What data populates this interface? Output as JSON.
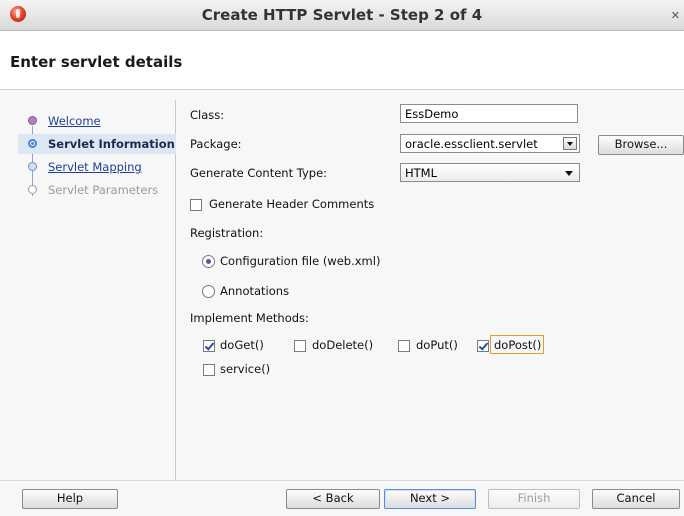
{
  "window": {
    "title": "Create HTTP Servlet - Step 2 of 4",
    "close_glyph": "✕",
    "app_icon": "oracle-jdeveloper-icon"
  },
  "header": {
    "title": "Enter servlet details"
  },
  "steps": [
    {
      "label": "Welcome",
      "state": "done"
    },
    {
      "label": "Servlet Information",
      "state": "active"
    },
    {
      "label": "Servlet Mapping",
      "state": "next"
    },
    {
      "label": "Servlet Parameters",
      "state": "disabled"
    }
  ],
  "form": {
    "class_label": "Class:",
    "class_value": "EssDemo",
    "package_label": "Package:",
    "package_value": "oracle.essclient.servlet",
    "browse_label": "Browse...",
    "content_type_label": "Generate Content Type:",
    "content_type_value": "HTML",
    "header_comments_label": "Generate Header Comments",
    "header_comments_checked": false,
    "registration_label": "Registration:",
    "registration_options": [
      {
        "label": "Configuration file (web.xml)",
        "selected": true
      },
      {
        "label": "Annotations",
        "selected": false
      }
    ],
    "methods_label": "Implement Methods:",
    "methods": [
      {
        "label": "doGet()",
        "checked": true
      },
      {
        "label": "doDelete()",
        "checked": false
      },
      {
        "label": "doPut()",
        "checked": false
      },
      {
        "label": "doPost()",
        "checked": true
      },
      {
        "label": "service()",
        "checked": false
      }
    ]
  },
  "footer": {
    "help_label": "Help",
    "back_label": "< Back",
    "next_label": "Next >",
    "finish_label": "Finish",
    "cancel_label": "Cancel"
  },
  "colors": {
    "link": "#1d3f9e",
    "active_step_bg": "#dde6f3",
    "default_button_border": "#5b8fd6",
    "focus_ring": "#e0a030"
  }
}
